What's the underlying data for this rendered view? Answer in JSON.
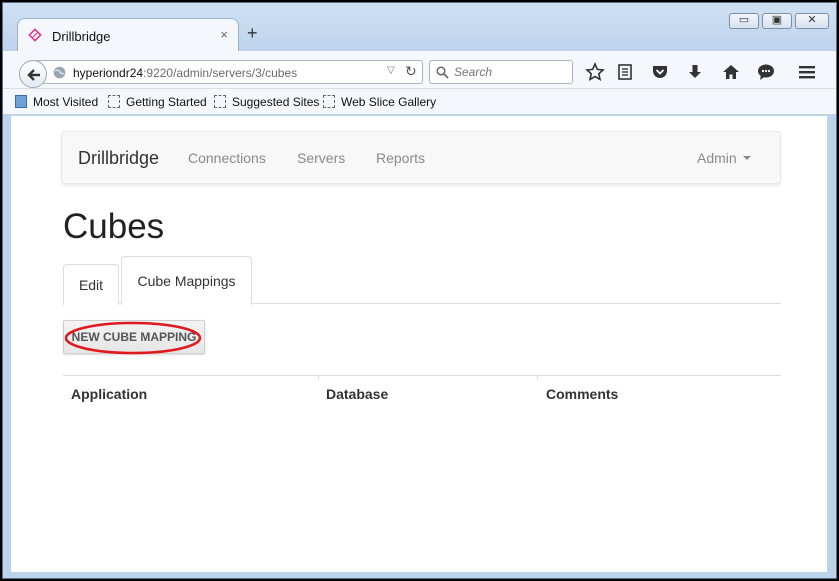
{
  "browser": {
    "tab": {
      "title": "Drillbridge",
      "close_glyph": "×"
    },
    "new_tab_glyph": "+",
    "window_controls": {
      "minimize": "▭",
      "maximize": "▣",
      "close": "✕"
    },
    "url": {
      "host": "hyperiondr24",
      "path": ":9220/admin/servers/3/cubes"
    },
    "search": {
      "placeholder": "Search"
    },
    "bookmarks": [
      "Most Visited",
      "Getting Started",
      "Suggested Sites",
      "Web Slice Gallery"
    ]
  },
  "app": {
    "brand": "Drillbridge",
    "nav": {
      "connections": "Connections",
      "servers": "Servers",
      "reports": "Reports",
      "admin": "Admin"
    },
    "page_title": "Cubes",
    "tabs": {
      "edit": "Edit",
      "cube_mappings": "Cube Mappings",
      "active": "Cube Mappings"
    },
    "new_button": "NEW CUBE MAPPING",
    "table": {
      "headers": [
        "Application",
        "Database",
        "Comments"
      ],
      "rows": []
    }
  },
  "colors": {
    "highlight": "#e0191f",
    "favicon": "#e0388f",
    "window_frame": "#bcd3ec"
  }
}
